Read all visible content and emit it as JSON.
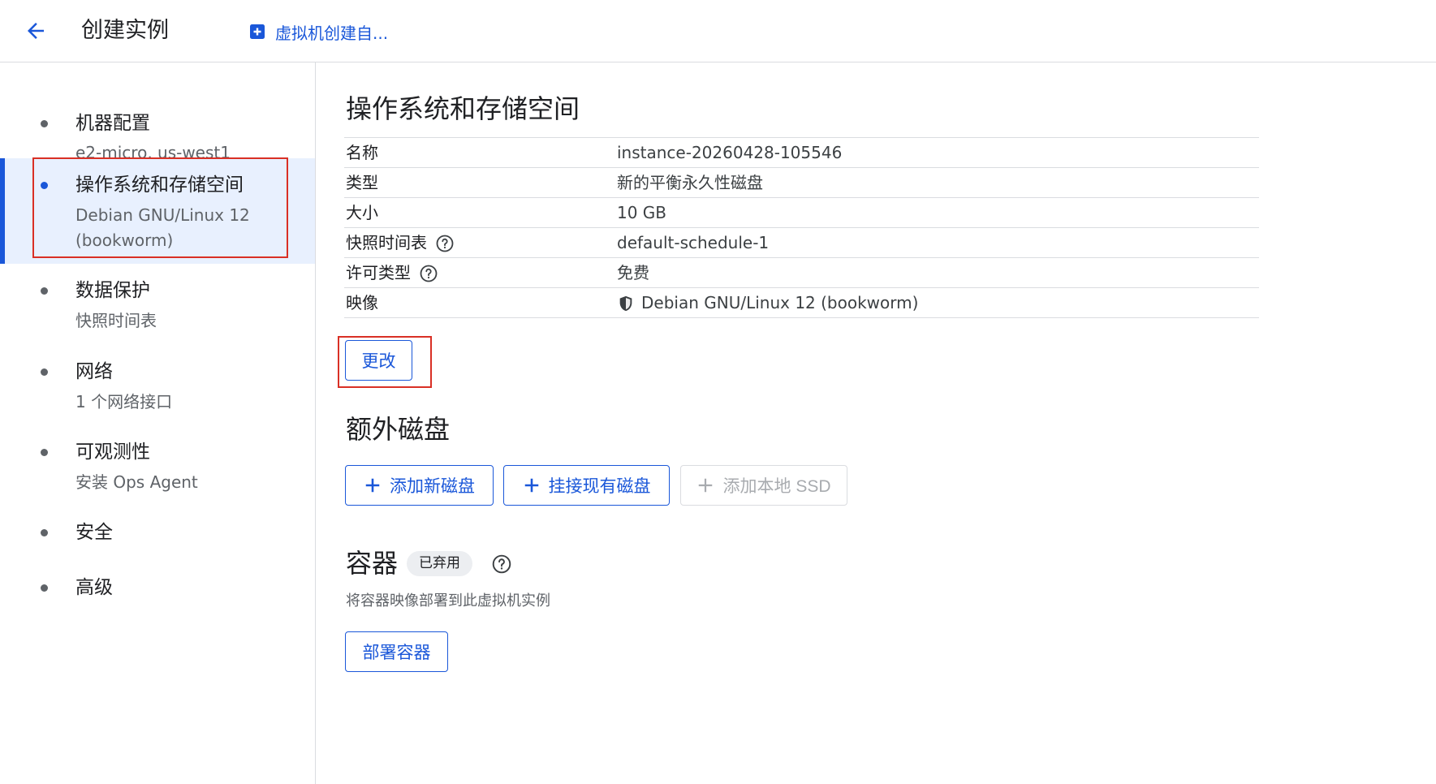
{
  "header": {
    "title": "创建实例",
    "doc_link": "虚拟机创建自..."
  },
  "sidebar": {
    "items": [
      {
        "label": "机器配置",
        "sub": "e2-micro, us-west1"
      },
      {
        "label": "操作系统和存储空间",
        "sub": "Debian GNU/Linux 12 (bookworm)"
      },
      {
        "label": "数据保护",
        "sub": "快照时间表"
      },
      {
        "label": "网络",
        "sub": "1 个网络接口"
      },
      {
        "label": "可观测性",
        "sub": "安装 Ops Agent"
      },
      {
        "label": "安全",
        "sub": ""
      },
      {
        "label": "高级",
        "sub": ""
      }
    ]
  },
  "os_storage": {
    "title": "操作系统和存储空间",
    "rows": [
      {
        "key": "名称",
        "value": "instance-20260428-105546"
      },
      {
        "key": "类型",
        "value": "新的平衡永久性磁盘"
      },
      {
        "key": "大小",
        "value": "10 GB"
      },
      {
        "key": "快照时间表",
        "value": "default-schedule-1"
      },
      {
        "key": "许可类型",
        "value": "免费"
      },
      {
        "key": "映像",
        "value": "Debian GNU/Linux 12 (bookworm)"
      }
    ],
    "change_label": "更改"
  },
  "extra_disks": {
    "title": "额外磁盘",
    "add_new_label": "添加新磁盘",
    "attach_existing_label": "挂接现有磁盘",
    "add_local_ssd_label": "添加本地 SSD"
  },
  "container": {
    "title": "容器",
    "badge": "已弃用",
    "description": "将容器映像部署到此虚拟机实例",
    "deploy_label": "部署容器"
  },
  "colors": {
    "accent": "#1a57d9",
    "highlight_box": "#d93025",
    "active_bg": "#e8f0fe"
  },
  "icons": {
    "back": "arrow-left-icon",
    "doc": "add-box-icon",
    "help": "help-circle-icon",
    "shield": "shield-icon",
    "plus": "plus-icon"
  }
}
